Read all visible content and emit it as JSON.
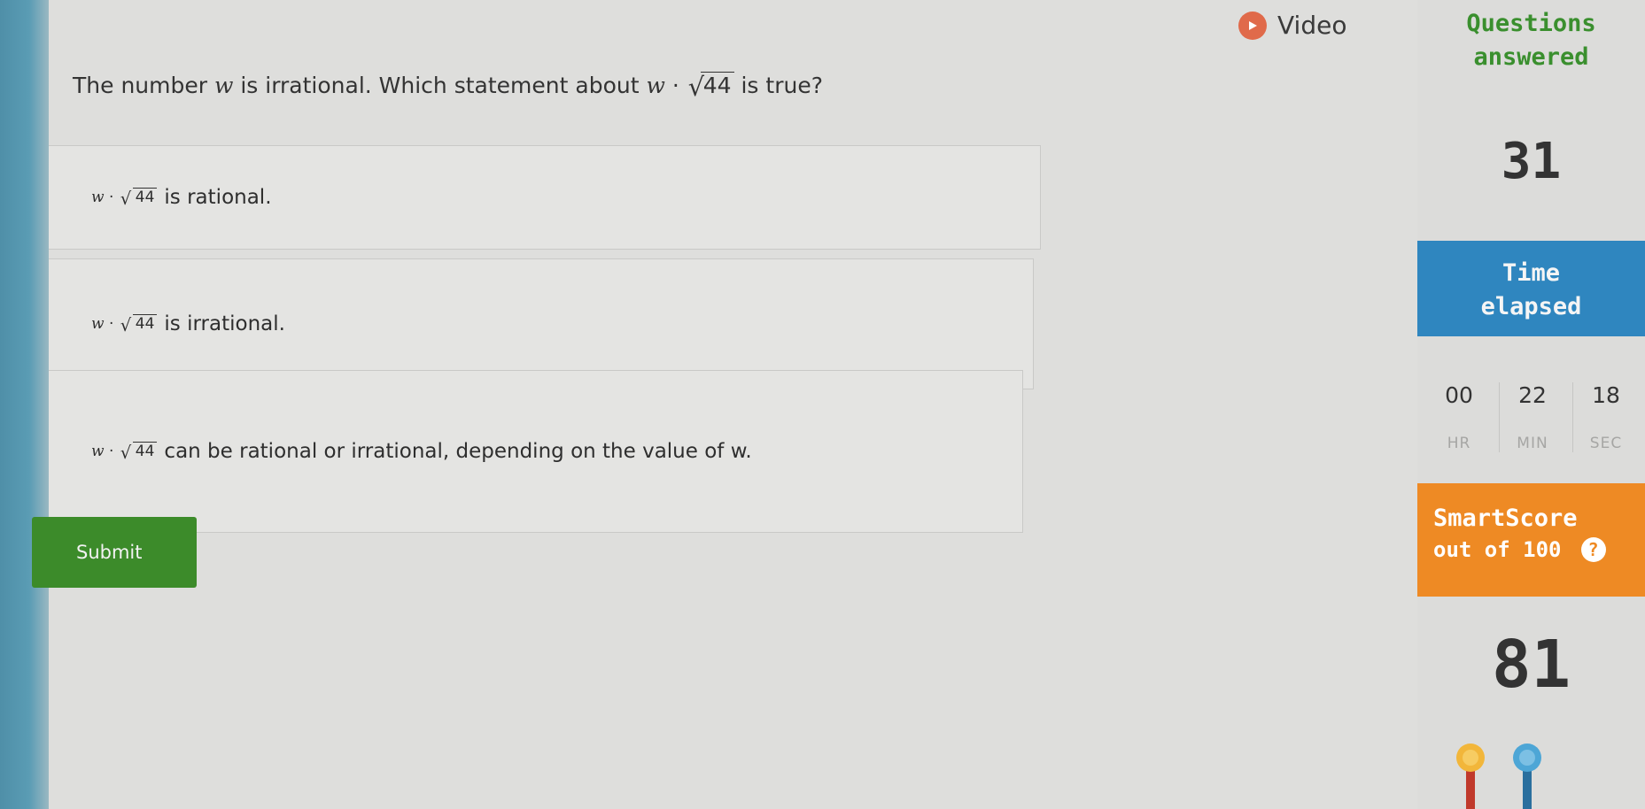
{
  "question": {
    "prefix": "The number",
    "var": "w",
    "middle": "is irrational. Which statement about",
    "radicand": "44",
    "suffix": "is true?"
  },
  "choices": [
    {
      "var": "w",
      "radicand": "44",
      "text": "is rational."
    },
    {
      "var": "w",
      "radicand": "44",
      "text": "is irrational."
    },
    {
      "var": "w",
      "radicand": "44",
      "text": "can be rational or irrational, depending on the value of w."
    }
  ],
  "submit_label": "Submit",
  "video_label": "Video",
  "sidebar": {
    "questions_answered": {
      "line1": "Questions",
      "line2": "answered",
      "value": "31"
    },
    "time_elapsed": {
      "line1": "Time",
      "line2": "elapsed",
      "hours": "00",
      "minutes": "22",
      "seconds": "18",
      "hr_label": "HR",
      "min_label": "MIN",
      "sec_label": "SEC"
    },
    "smartscore": {
      "title": "SmartScore",
      "subtitle": "out of 100",
      "help": "?",
      "value": "81"
    }
  },
  "icons": {
    "video": "play-icon",
    "help": "help-icon",
    "medal": "medal-icon"
  },
  "colors": {
    "submit": "#3c8b2a",
    "time_band": "#2f86bf",
    "score_band": "#ee8a24",
    "label_green": "#3a8f2e",
    "medal_gold": "#f2b63a",
    "medal_blue": "#4da6d6"
  }
}
